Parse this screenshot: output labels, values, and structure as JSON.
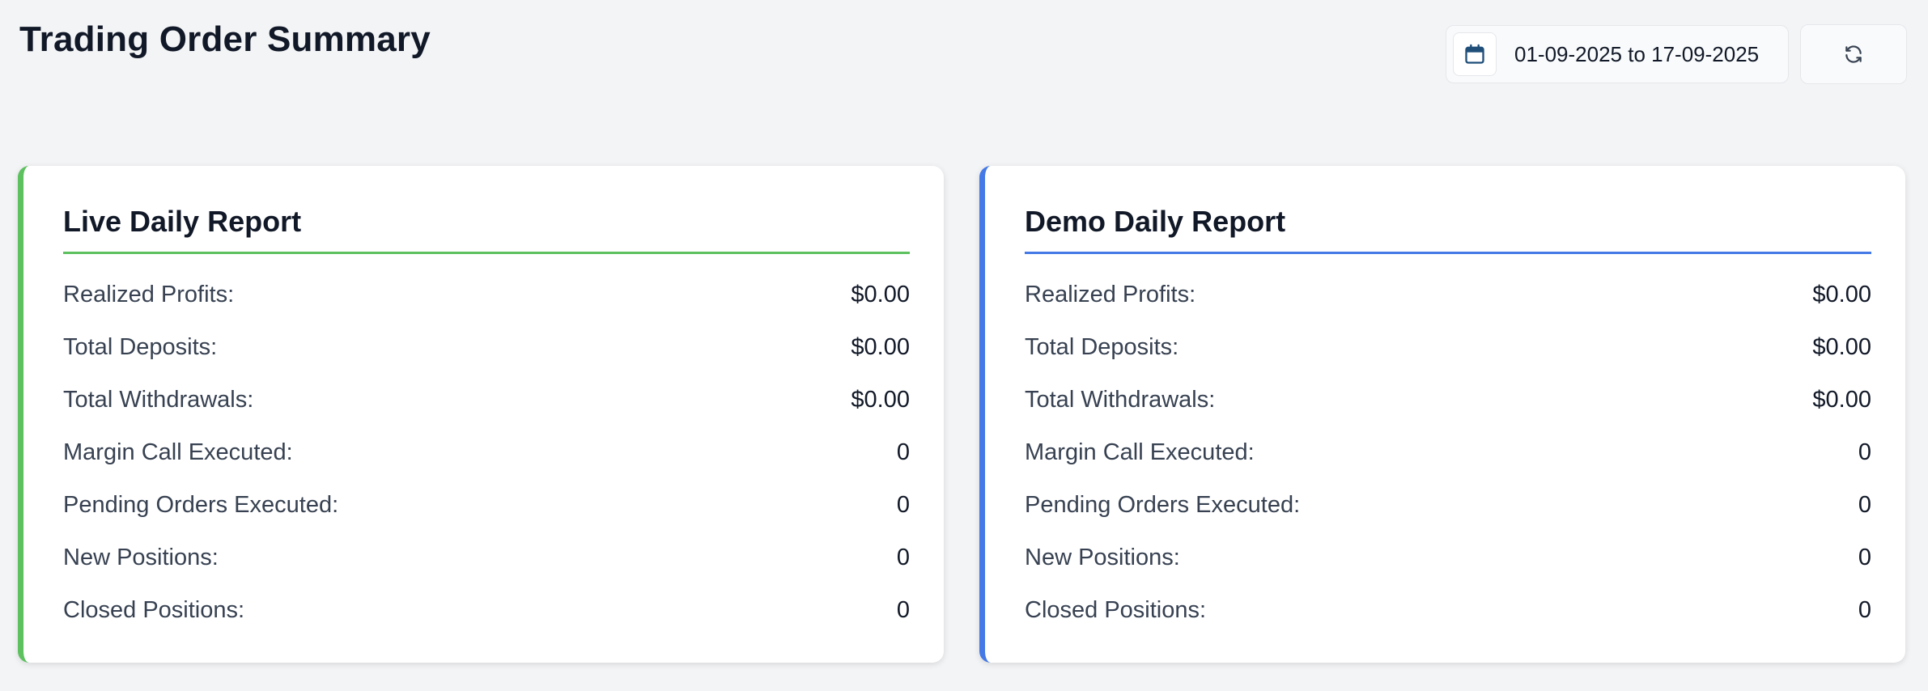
{
  "header": {
    "title": "Trading Order Summary",
    "date_range": "01-09-2025 to 17-09-2025",
    "calendar_icon": "calendar-icon",
    "refresh_icon": "refresh-icon"
  },
  "cards": {
    "live": {
      "title": "Live Daily Report",
      "accent": "#5cc15e",
      "rows": [
        {
          "label": "Realized Profits:",
          "value": "$0.00"
        },
        {
          "label": "Total Deposits:",
          "value": "$0.00"
        },
        {
          "label": "Total Withdrawals:",
          "value": "$0.00"
        },
        {
          "label": "Margin Call Executed:",
          "value": "0"
        },
        {
          "label": "Pending Orders Executed:",
          "value": "0"
        },
        {
          "label": "New Positions:",
          "value": "0"
        },
        {
          "label": "Closed Positions:",
          "value": "0"
        }
      ]
    },
    "demo": {
      "title": "Demo Daily Report",
      "accent": "#4479e6",
      "rows": [
        {
          "label": "Realized Profits:",
          "value": "$0.00"
        },
        {
          "label": "Total Deposits:",
          "value": "$0.00"
        },
        {
          "label": "Total Withdrawals:",
          "value": "$0.00"
        },
        {
          "label": "Margin Call Executed:",
          "value": "0"
        },
        {
          "label": "Pending Orders Executed:",
          "value": "0"
        },
        {
          "label": "New Positions:",
          "value": "0"
        },
        {
          "label": "Closed Positions:",
          "value": "0"
        }
      ]
    }
  }
}
